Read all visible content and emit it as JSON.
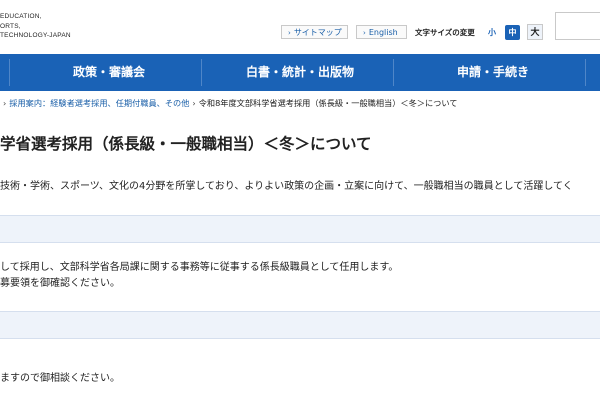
{
  "header": {
    "logo_lines": [
      "EDUCATION,",
      "ORTS,",
      "TECHNOLOGY-JAPAN"
    ],
    "sitemap_label": "サイトマップ",
    "english_label": "English",
    "font_size_label": "文字サイズの変更",
    "font_small": "小",
    "font_medium": "中",
    "font_large": "大"
  },
  "nav": {
    "items": [
      {
        "label": "政策・審議会"
      },
      {
        "label": "白書・統計・出版物"
      },
      {
        "label": "申請・手続き"
      }
    ]
  },
  "breadcrumb": {
    "parent": "採用案内：経験者選考採用、任期付職員、その他",
    "current": "令和8年度文部科学省選考採用（係長級・一般職相当）＜冬＞について"
  },
  "page": {
    "title": "学省選考採用（係長級・一般職相当）＜冬＞について",
    "intro": "技術・学術、スポーツ、文化の4分野を所掌しており、よりよい政策の企画・立案に向けて、一般職相当の職員として活躍してく",
    "section1_lines": [
      "して採用し、文部科学省各局課に関する事務等に従事する係長級職員として任用します。",
      "募要領を御確認ください。"
    ],
    "section2_line": "ますので御相談ください。"
  }
}
